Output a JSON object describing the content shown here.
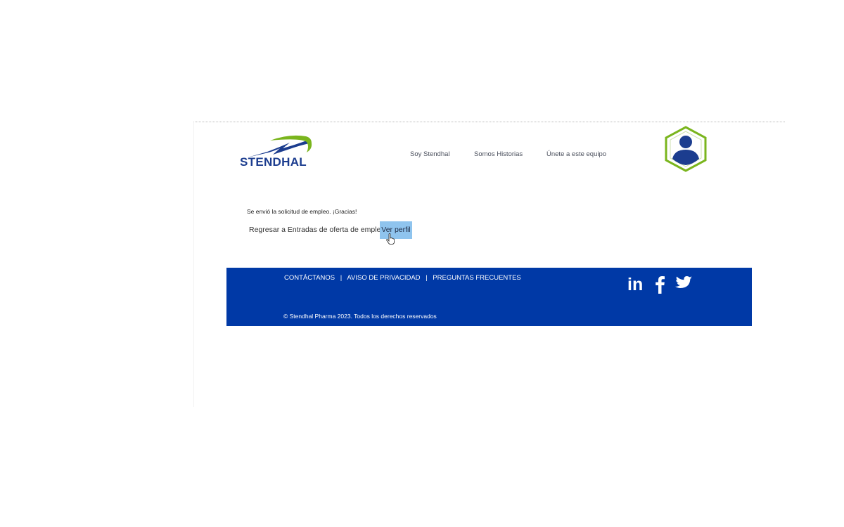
{
  "brand": {
    "name": "STENDHAL"
  },
  "nav": {
    "items": [
      {
        "label": "Soy Stendhal"
      },
      {
        "label": "Somos Historias"
      },
      {
        "label": "Únete a este equipo"
      }
    ]
  },
  "main": {
    "success_message": "Se envió la solicitud de empleo. ¡Gracias!",
    "back_link": "Regresar a Entradas de oferta de empleo",
    "view_profile": "Ver perfil"
  },
  "footer": {
    "links": [
      {
        "label": "CONTÁCTANOS"
      },
      {
        "label": "AVISO DE PRIVACIDAD"
      },
      {
        "label": "PREGUNTAS FRECUENTES"
      }
    ],
    "separator": "|",
    "copyright": "© Stendhal Pharma 2023. Todos los derechos reservados",
    "social": {
      "linkedin": "in",
      "facebook": "facebook-icon",
      "twitter": "twitter-icon"
    }
  },
  "icons": {
    "profile": "user-profile-icon",
    "cursor": "hand-pointer-cursor"
  },
  "colors": {
    "brand_blue": "#1c3d8f",
    "brand_green": "#7ab51d",
    "footer_bg": "#0039a6",
    "button_highlight": "#8fc4ee",
    "badge_border": "#7ab51d"
  }
}
